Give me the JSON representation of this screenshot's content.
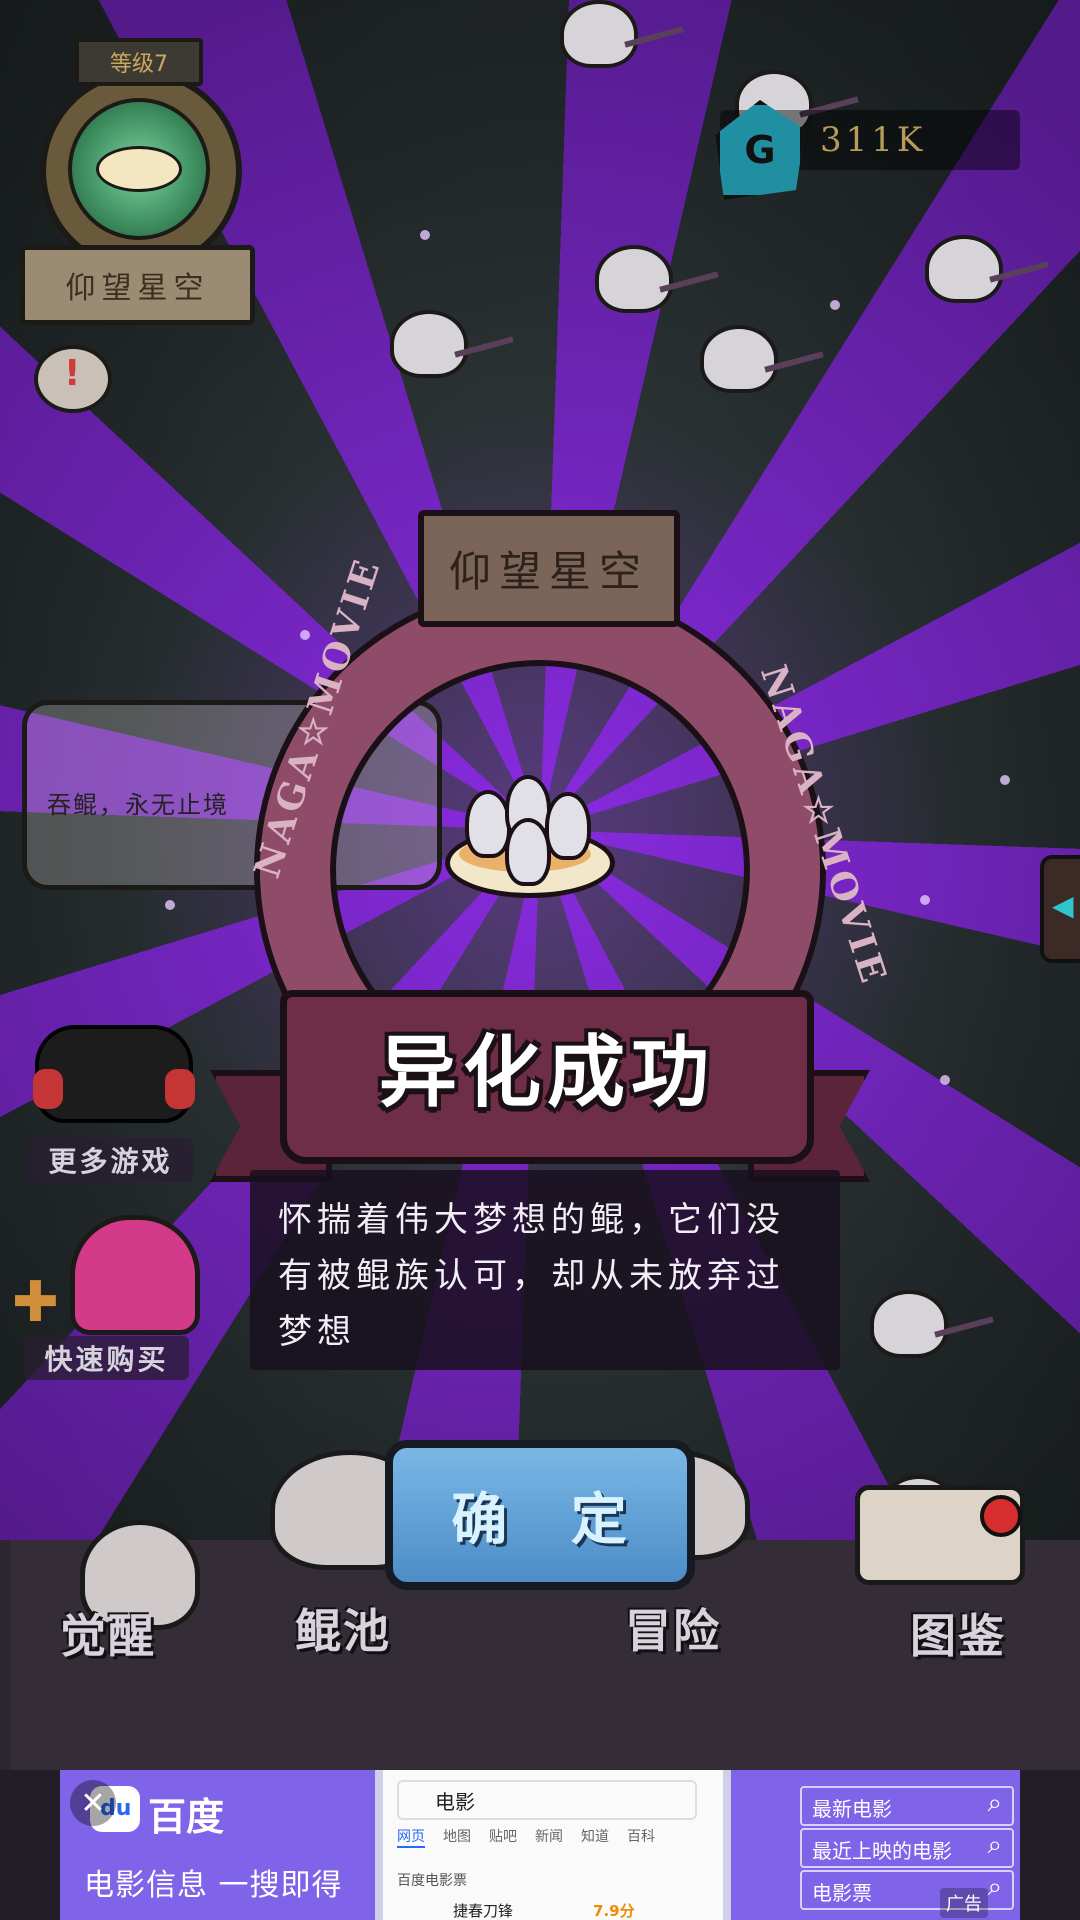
{
  "hud": {
    "level_label": "等级7",
    "player_title": "仰望星空",
    "currency_icon": "G",
    "currency_value": "311K"
  },
  "left_panel": {
    "quote": "吞鲲，永无止境",
    "more_games": "更多游戏",
    "quick_buy": "快速购买"
  },
  "modal": {
    "plaque_title": "仰望星空",
    "ring_text_left": "NAGA☆MOVIE",
    "ring_text_right": "NAGA☆MOVIE",
    "banner_title": "异化成功",
    "description": "怀揣着伟大梦想的鲲，它们没有被鲲族认可，却从未放弃过梦想",
    "confirm_button": "确 定"
  },
  "bottom_nav": {
    "items": [
      {
        "label": "觉醒"
      },
      {
        "label": "鲲池"
      },
      {
        "label": "冒险"
      },
      {
        "label": "图鉴"
      }
    ]
  },
  "ad": {
    "close": "✕",
    "brand": "百度",
    "slogan": "电影信息 一搜即得",
    "search_query": "电影",
    "tabs": [
      "网页",
      "地图",
      "贴吧",
      "新闻",
      "知道",
      "百科"
    ],
    "row1": "百度电影票",
    "row2_title": "捷春刀锋",
    "row2_score": "7.9分",
    "suggestions": [
      "最新电影",
      "最近上映的电影",
      "电影票"
    ],
    "ad_label": "广告"
  },
  "colors": {
    "ray_purple": "#8c28eb",
    "banner_maroon": "#6f2e48",
    "button_blue": "#4c8dc7"
  }
}
